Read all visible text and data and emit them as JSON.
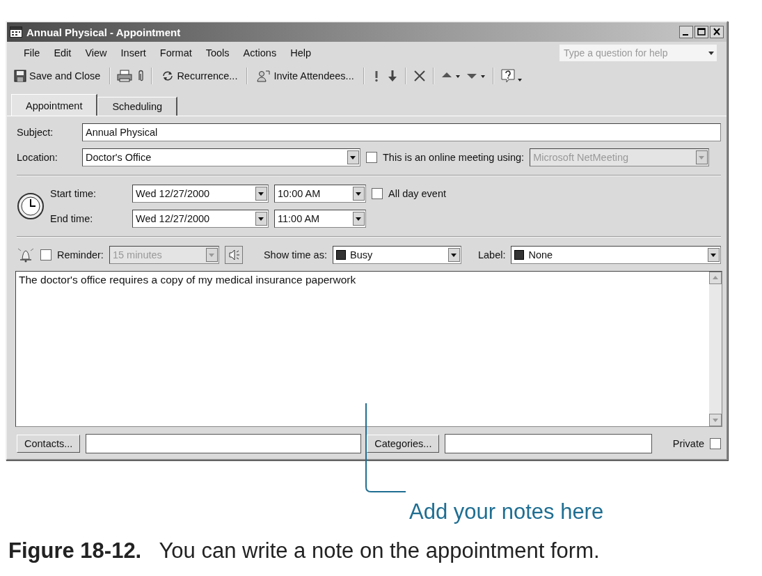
{
  "window": {
    "title": "Annual Physical - Appointment"
  },
  "menu": [
    "File",
    "Edit",
    "View",
    "Insert",
    "Format",
    "Tools",
    "Actions",
    "Help"
  ],
  "help_box": {
    "placeholder": "Type a question for help"
  },
  "toolbar": {
    "save_button": "Save and Close",
    "recurrence_button": "Recurrence...",
    "invite_button": "Invite Attendees..."
  },
  "tabs": [
    {
      "label": "Appointment",
      "selected": true
    },
    {
      "label": "Scheduling",
      "selected": false
    }
  ],
  "subject": {
    "label": "Subject:",
    "value": "Annual Physical"
  },
  "location": {
    "label": "Location:",
    "value": "Doctor's Office"
  },
  "online_meeting": {
    "label": "This is an online meeting using:",
    "checked": false,
    "program": "Microsoft NetMeeting",
    "program_disabled": true
  },
  "start_time": {
    "label": "Start time:",
    "date": "Wed 12/27/2000",
    "time": "10:00 AM"
  },
  "end_time": {
    "label": "End time:",
    "date": "Wed 12/27/2000",
    "time": "11:00 AM"
  },
  "all_day_event": {
    "label": "All day event",
    "checked": false
  },
  "reminder": {
    "label": "Reminder:",
    "checked": false,
    "value": "15 minutes",
    "disabled": true
  },
  "show_time_as": {
    "label": "Show time as:",
    "value": "Busy"
  },
  "label_field": {
    "label": "Label:",
    "value": "None"
  },
  "notes": {
    "value": "The doctor's office requires a copy of my medical insurance paperwork"
  },
  "footer": {
    "contacts_button": "Contacts...",
    "categories_button": "Categories...",
    "private": {
      "label": "Private",
      "checked": false
    }
  },
  "callout": "Add your notes here",
  "caption": "**Figure 18-12.**   You can write a note on the appointment form."
}
